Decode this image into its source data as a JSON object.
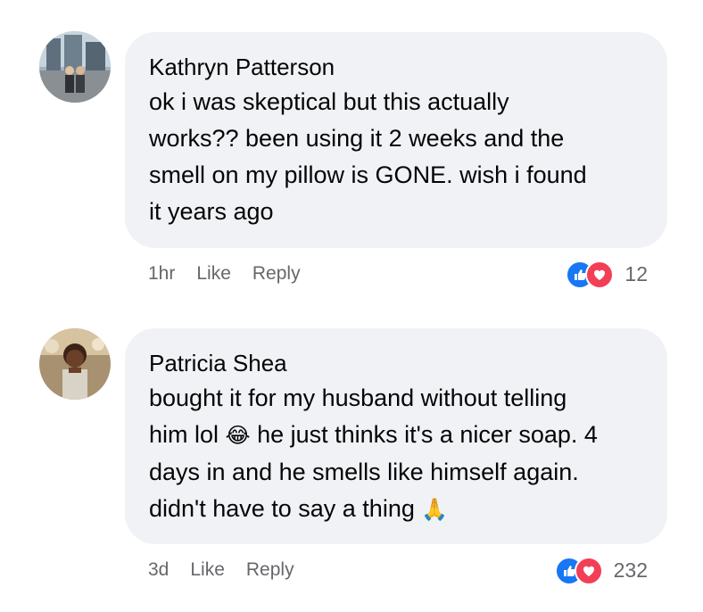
{
  "comments": [
    {
      "author": "Kathryn Patterson",
      "text": "ok i was skeptical but this actually\nworks?? been using it 2 weeks and the\nsmell on my pillow is GONE. wish i found\nit years ago",
      "time": "1hr",
      "like_label": "Like",
      "reply_label": "Reply",
      "reaction_count": "12",
      "reactions": [
        "like-icon",
        "love-icon"
      ]
    },
    {
      "author": "Patricia Shea",
      "text_parts": [
        "bought it for my husband without telling\nhim lol ",
        " he just thinks it's a nicer soap. 4\ndays in and he smells like himself again.\ndidn't have to say a thing "
      ],
      "emoji_1": "😂",
      "emoji_2": "🙏",
      "time": "3d",
      "like_label": "Like",
      "reply_label": "Reply",
      "reaction_count": "232",
      "reactions": [
        "like-icon",
        "love-icon"
      ]
    }
  ],
  "colors": {
    "bubble": "#f0f2f5",
    "meta_text": "#65676b",
    "like_blue": "#1877f2",
    "love_red": "#f33e58"
  }
}
